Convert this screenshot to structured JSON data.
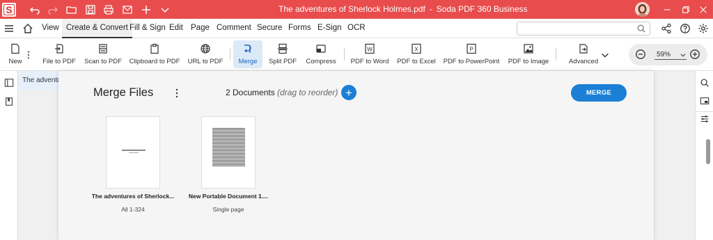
{
  "window": {
    "title": "The adventures of Sherlock Holmes.pdf",
    "separator": "-",
    "app_name": "Soda PDF 360 Business",
    "logo_letter": "S"
  },
  "menu": {
    "items": [
      "View",
      "Create & Convert",
      "Fill & Sign",
      "Edit",
      "Page",
      "Comment",
      "Secure",
      "Forms",
      "E-Sign",
      "OCR"
    ],
    "active": "Create & Convert",
    "search_placeholder": ""
  },
  "toolbar": {
    "new_label": "New",
    "tools": [
      {
        "label": "File to PDF",
        "icon": "file-import-icon"
      },
      {
        "label": "Scan to PDF",
        "icon": "scanner-icon"
      },
      {
        "label": "Clipboard to PDF",
        "icon": "clipboard-icon"
      },
      {
        "label": "URL to PDF",
        "icon": "globe-icon"
      },
      {
        "label": "Merge",
        "icon": "merge-icon"
      },
      {
        "label": "Split PDF",
        "icon": "split-icon"
      },
      {
        "label": "Compress",
        "icon": "compress-icon"
      },
      {
        "label": "PDF to Word",
        "icon": "word-icon",
        "letter": "W"
      },
      {
        "label": "PDF to Excel",
        "icon": "excel-icon",
        "letter": "X"
      },
      {
        "label": "PDF to PowerPoint",
        "icon": "powerpoint-icon",
        "letter": "P"
      },
      {
        "label": "PDF to Image",
        "icon": "image-icon"
      },
      {
        "label": "Advanced",
        "icon": "advanced-icon"
      }
    ],
    "zoom": "59%"
  },
  "doc_tab": {
    "label": "The adventures of Sherlock Holmes"
  },
  "merge_panel": {
    "title": "Merge Files",
    "doc_count": "2 Documents",
    "hint": "(drag to reorder)",
    "add_label": "+",
    "merge_label": "MERGE",
    "files": [
      {
        "name": "The adventures of Sherlock...",
        "range": "All 1-324"
      },
      {
        "name": "New Portable Document 1....",
        "range": "Single page"
      }
    ]
  },
  "colors": {
    "titlebar": "#e84c4c",
    "accent": "#1b7fd6"
  }
}
